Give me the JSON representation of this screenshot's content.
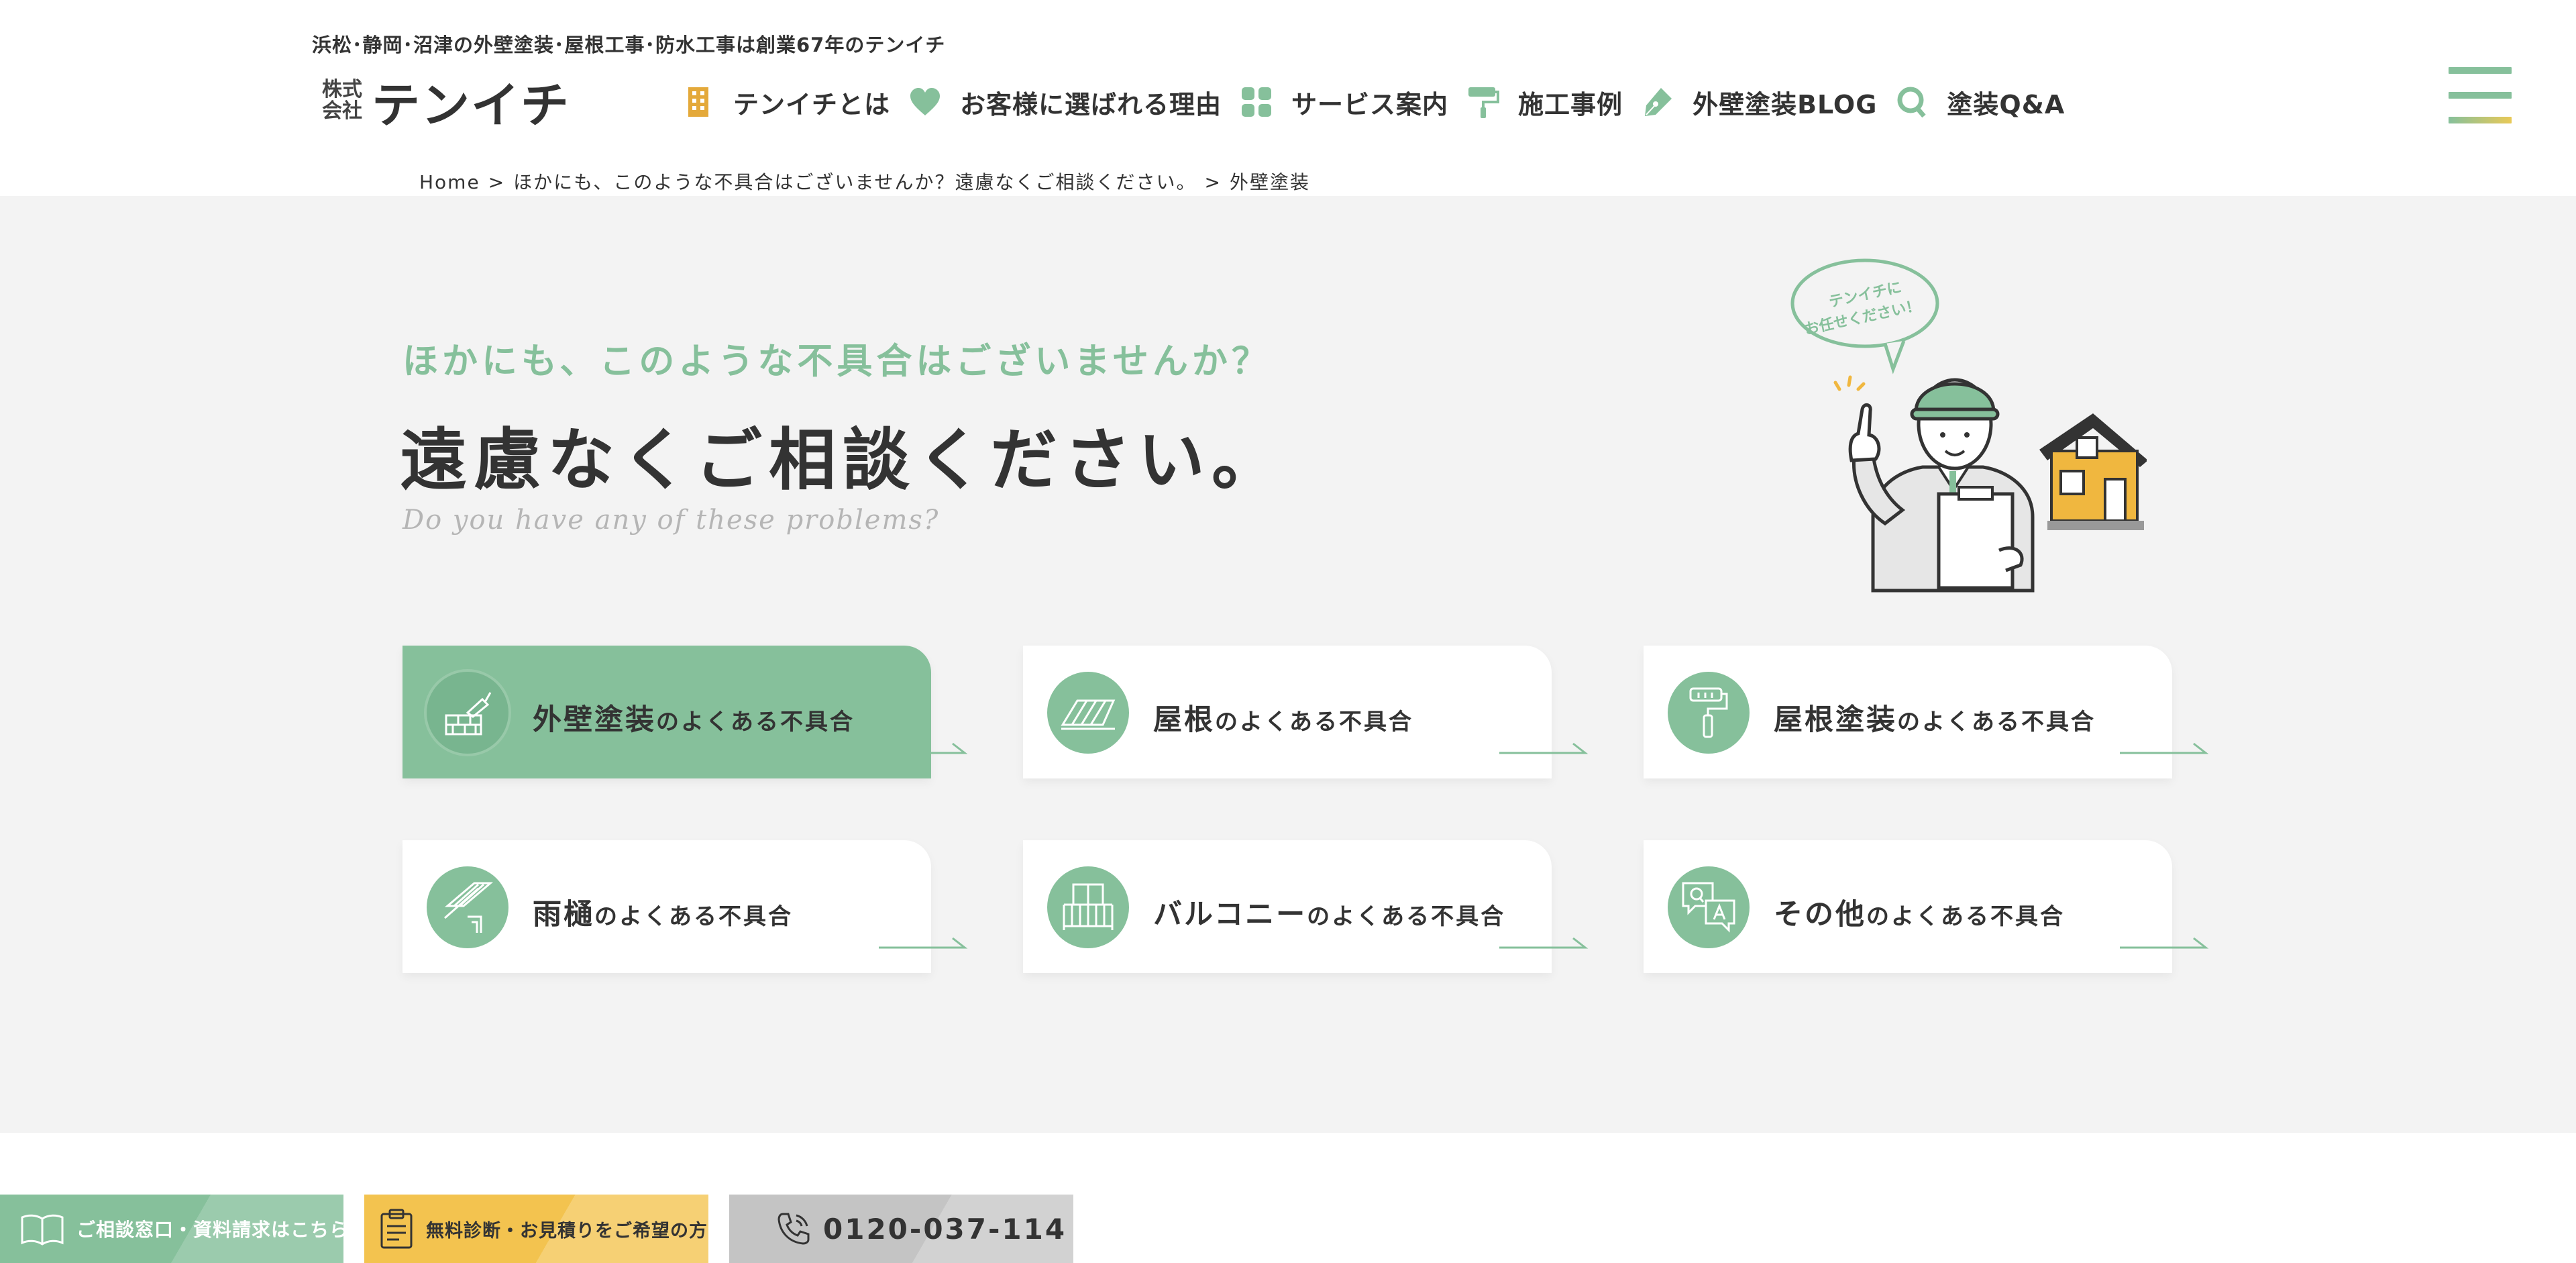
{
  "header": {
    "tagline": "浜松･静岡･沼津の外壁塗装･屋根工事･防水工事は創業67年のテンイチ",
    "logo_small_1": "株式",
    "logo_small_2": "会社",
    "logo_main": "テンイチ",
    "nav": [
      {
        "label": "テンイチとは",
        "icon": "building-icon"
      },
      {
        "label": "お客様に選ばれる理由",
        "icon": "heart-icon"
      },
      {
        "label": "サービス案内",
        "icon": "grid-icon"
      },
      {
        "label": "施工事例",
        "icon": "paint-roller-icon"
      },
      {
        "label": "外壁塗装BLOG",
        "icon": "pen-nib-icon"
      },
      {
        "label": "塗装Q&A",
        "icon": "q-icon"
      }
    ],
    "menu_icon": "hamburger-menu-icon"
  },
  "breadcrumb": {
    "items": [
      "Home",
      "ほかにも、このような不具合はございませんか？遠慮なくご相談ください。",
      "外壁塗装"
    ],
    "separator": ">"
  },
  "hero": {
    "kicker": "ほかにも、このような不具合はございませんか？",
    "headline": "遠慮なくご相談ください。",
    "subtitle_en": "Do you have any of these problems?",
    "speech_bubble_line1": "テンイチに",
    "speech_bubble_line2": "お任せください！"
  },
  "cards": [
    {
      "main": "外壁塗装",
      "tail": "のよくある不具合",
      "icon": "brick-wall-trowel-icon",
      "active": true
    },
    {
      "main": "屋根",
      "tail": "のよくある不具合",
      "icon": "roof-icon",
      "active": false
    },
    {
      "main": "屋根塗装",
      "tail": "のよくある不具合",
      "icon": "paint-roller-icon",
      "active": false
    },
    {
      "main": "雨樋",
      "tail": "のよくある不具合",
      "icon": "rain-gutter-icon",
      "active": false
    },
    {
      "main": "バルコニー",
      "tail": "のよくある不具合",
      "icon": "balcony-icon",
      "active": false
    },
    {
      "main": "その他",
      "tail": "のよくある不具合",
      "icon": "qa-chat-icon",
      "active": false
    }
  ],
  "cta": {
    "consult_label": "ご相談窓口・資料請求はこちら",
    "estimate_label": "無料診断・お見積りをご希望の方",
    "phone_label": "0120-037-114"
  },
  "colors": {
    "accent_green": "#86c09b",
    "accent_yellow": "#f3c34f",
    "gray_bg": "#f3f3f3",
    "phone_gray": "#c4c4c4"
  }
}
